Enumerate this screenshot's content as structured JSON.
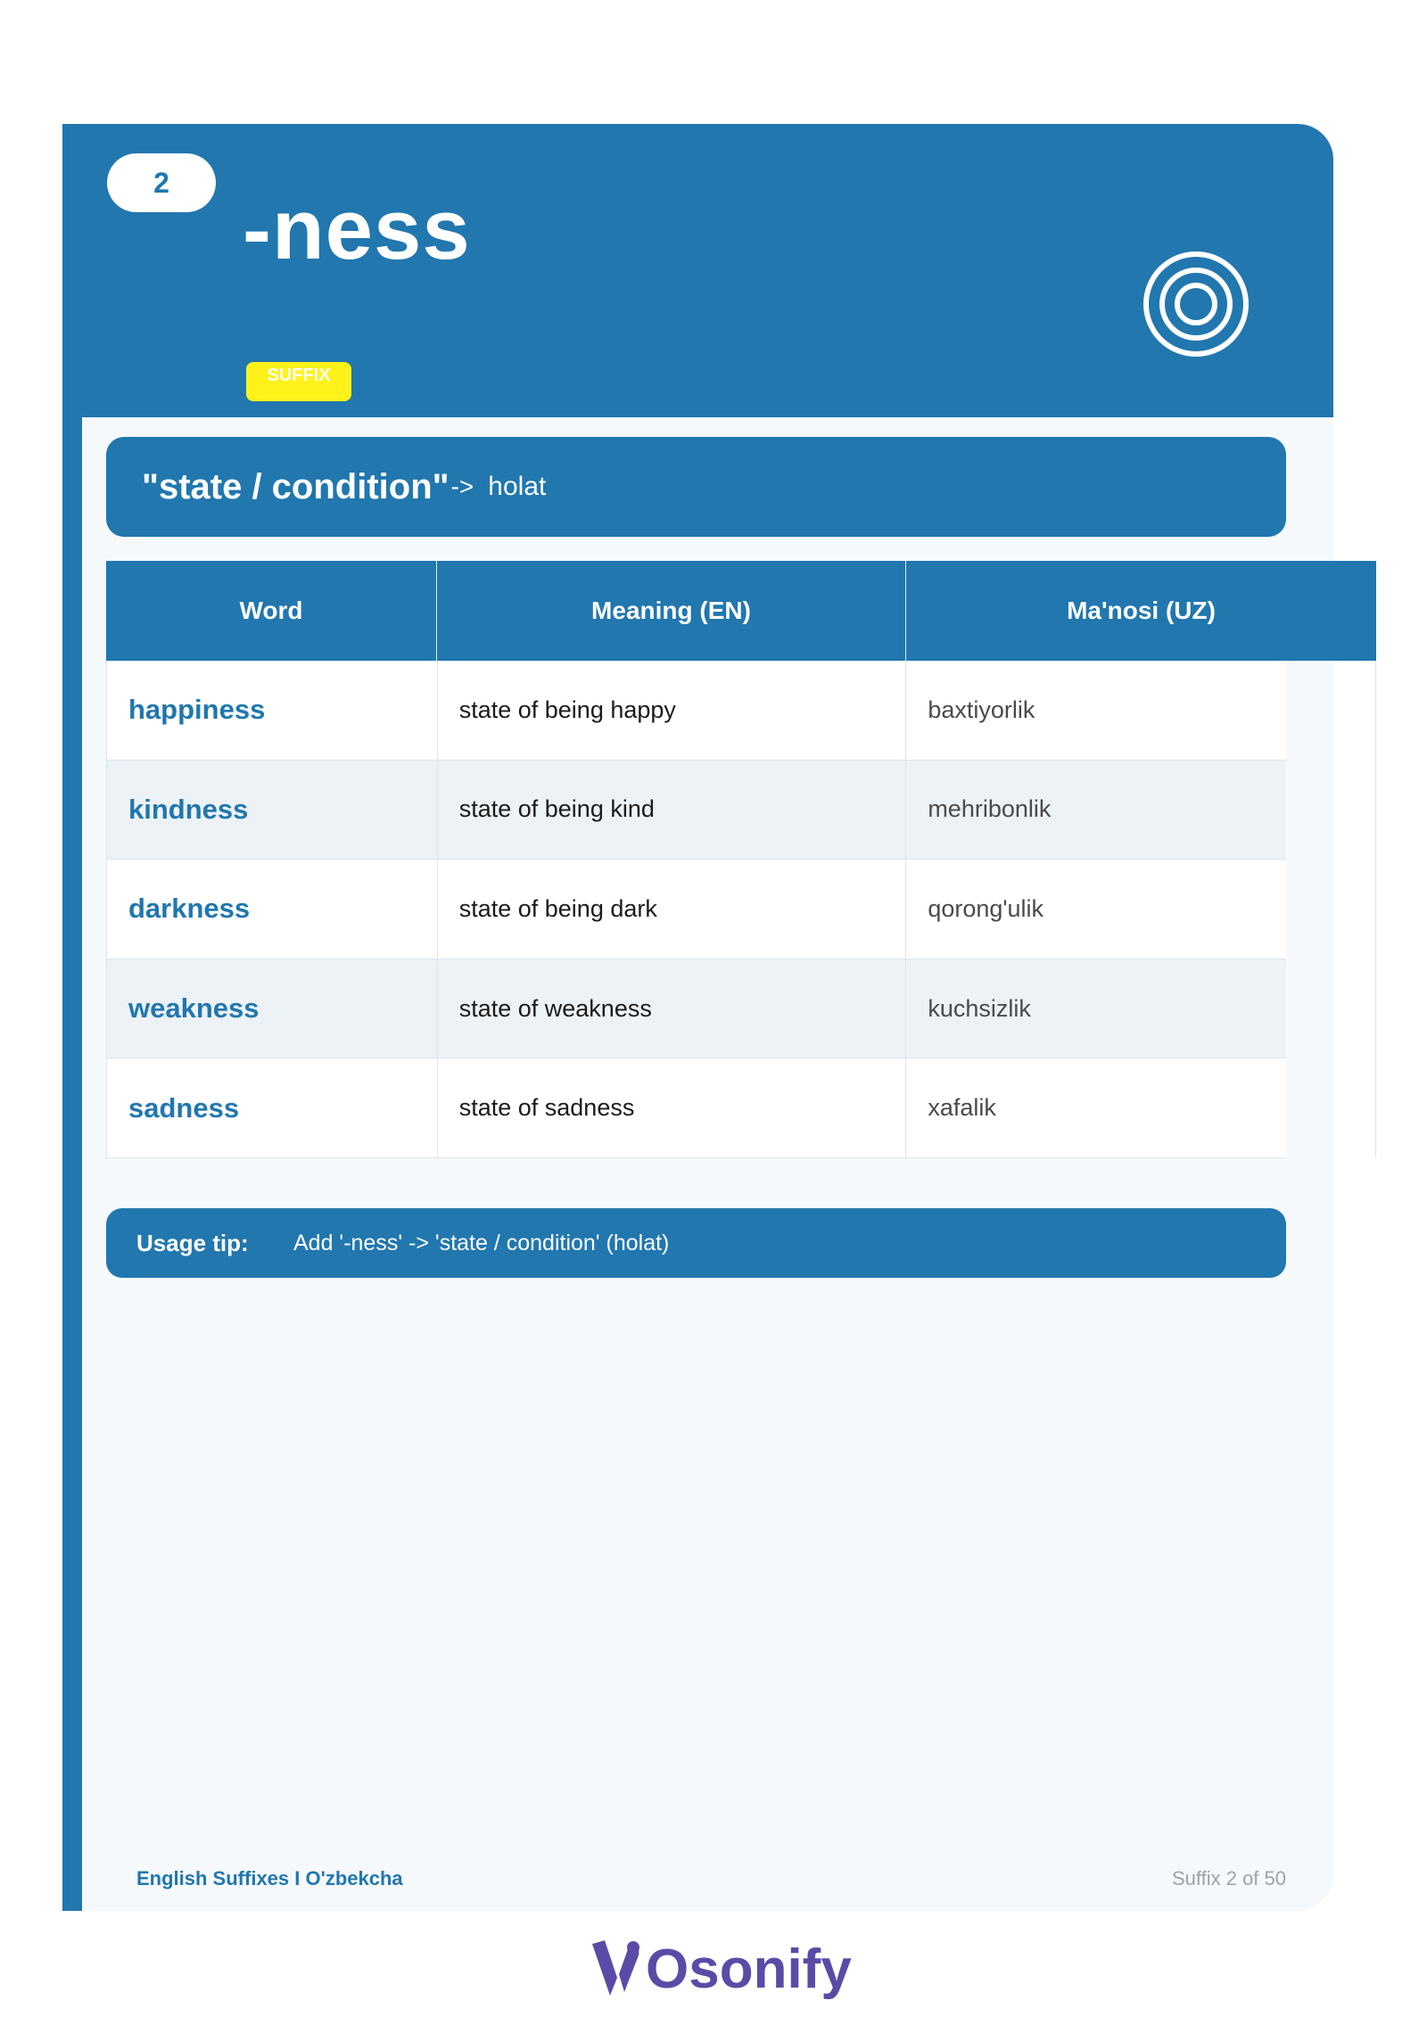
{
  "header": {
    "number": "2",
    "suffix": "-ness",
    "badge": "SUFFIX",
    "icon": "target-icon",
    "accent_color": "#2177ae",
    "badge_color": "#fff21a"
  },
  "meaning": {
    "quote": "\"state / condition\"",
    "arrow": "->",
    "uzbek": "holat"
  },
  "table": {
    "headers": [
      "Word",
      "Meaning (EN)",
      "Ma'nosi (UZ)"
    ],
    "rows": [
      {
        "word": "happiness",
        "en": "state of being happy",
        "uz": "baxtiyorlik"
      },
      {
        "word": "kindness",
        "en": "state of being kind",
        "uz": "mehribonlik"
      },
      {
        "word": "darkness",
        "en": "state of being dark",
        "uz": "qorong'ulik"
      },
      {
        "word": "weakness",
        "en": "state of weakness",
        "uz": "kuchsizlik"
      },
      {
        "word": "sadness",
        "en": "state of sadness",
        "uz": "xafalik"
      }
    ]
  },
  "tip": {
    "label": "Usage tip:",
    "text": "Add '-ness' -> 'state / condition' (holat)"
  },
  "footer": {
    "left": "English Suffixes I O'zbekcha",
    "right": "Suffix 2 of 50"
  },
  "brand": {
    "name": "Osonify",
    "color": "#5b4ba6"
  }
}
